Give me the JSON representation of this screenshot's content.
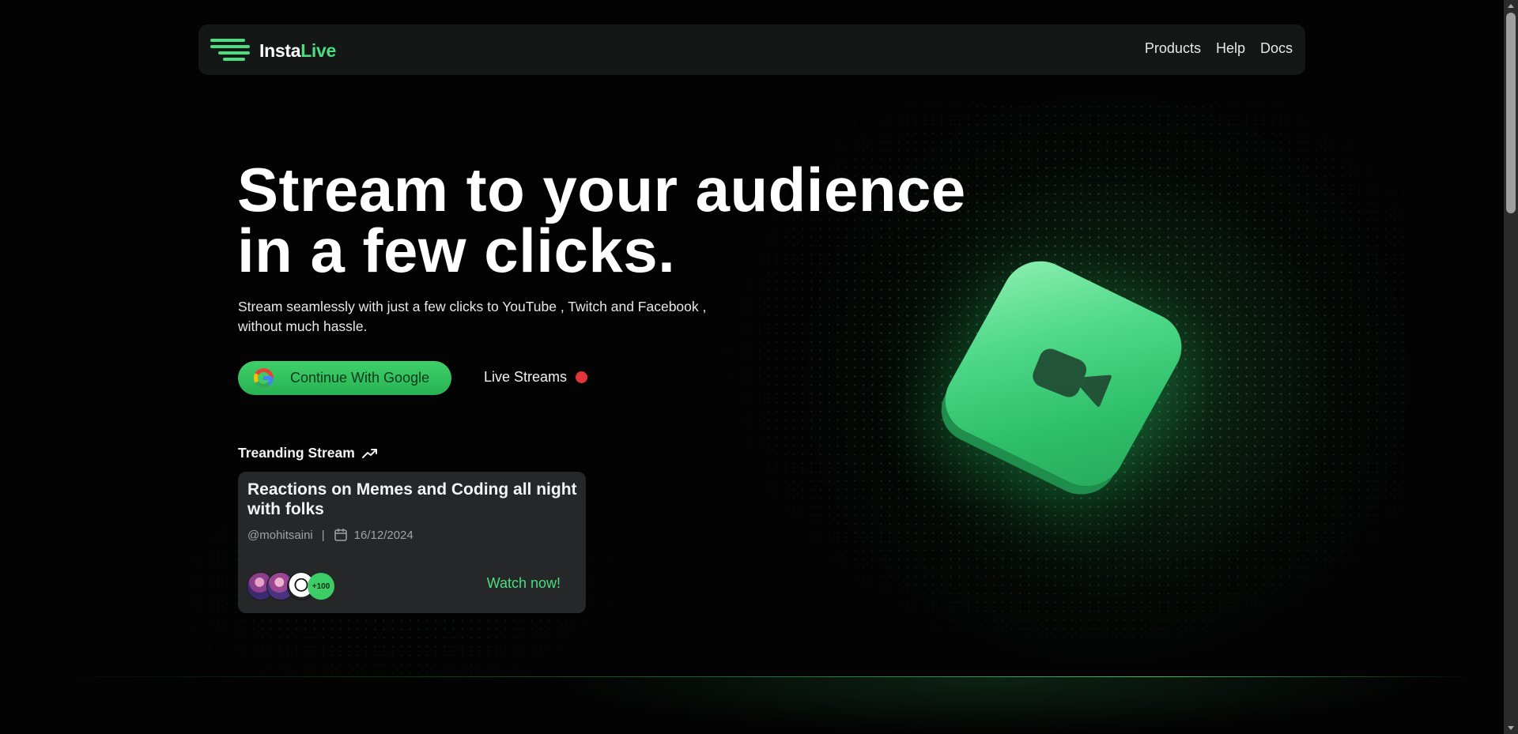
{
  "brand": {
    "part1": "Insta",
    "part2": "Live"
  },
  "nav": {
    "items": [
      "Products",
      "Help",
      "Docs"
    ]
  },
  "hero": {
    "title_line1": "Stream to your audience",
    "title_line2": "in a few clicks.",
    "subtitle_line1": "Stream seamlessly with just a few clicks to YouTube , Twitch and Facebook ,",
    "subtitle_line2": "without much hassle.",
    "google_button": "Continue With Google",
    "live_streams": "Live Streams"
  },
  "trending": {
    "label": "Treanding Stream",
    "card": {
      "title": "Reactions on Memes and Coding all night with folks",
      "author": "@mohitsaini",
      "separator": "|",
      "date": "16/12/2024",
      "extra_viewers": "+100",
      "watch_label": "Watch now!"
    }
  },
  "colors": {
    "accent": "#4ade80",
    "live": "#e0353b",
    "card": "#262729",
    "navbar": "#151616"
  },
  "icons": [
    "menu-lines-icon",
    "google-icon",
    "live-dot-icon",
    "trending-up-icon",
    "calendar-icon",
    "video-camera-icon"
  ]
}
